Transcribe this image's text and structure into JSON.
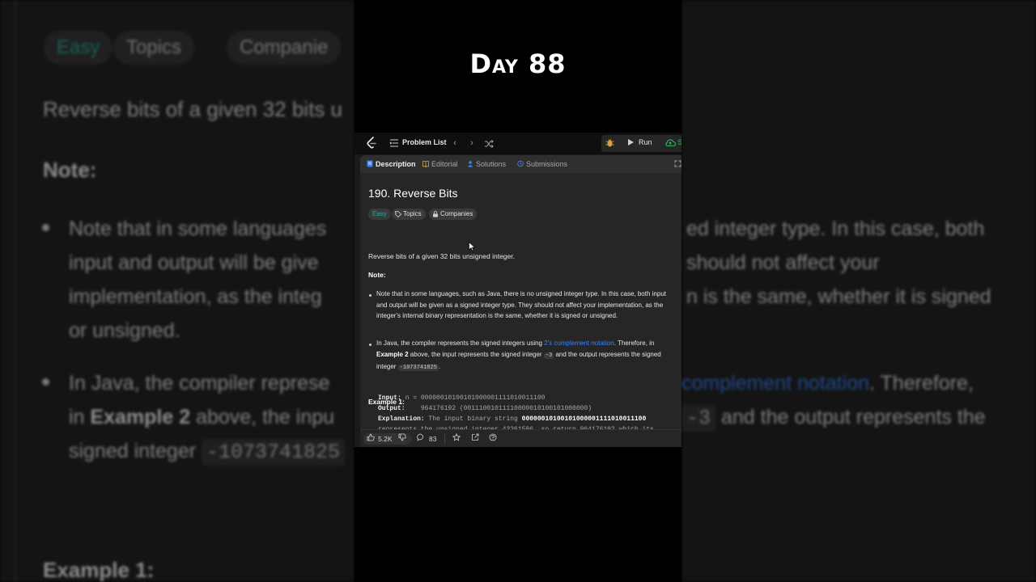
{
  "overlay": {
    "day_title": "Day 88"
  },
  "background": {
    "tags": [
      "Easy",
      "Topics",
      "Companie"
    ],
    "intro": "Reverse bits of a given 32 bits u",
    "note_heading": "Note:",
    "left_lines": [
      "Note that in some languages",
      "input and output will be give",
      "implementation, as the integ",
      "or unsigned.",
      "In Java, the compiler represe",
      "above, the inpu",
      "signed integer"
    ],
    "left_example2": "Example 2",
    "left_in": "in",
    "left_code": "-1073741825",
    "right_lines": [
      "ed integer type. In this case, both",
      "should not affect your",
      "n is the same, whether it is signed"
    ],
    "right_link": "complement notation",
    "right_therefore": ". Therefore,",
    "right_code": "-3",
    "right_tail": " and the output represents the",
    "example_heading": "Example 1:"
  },
  "topbar": {
    "problem_list": "Problem List",
    "run": "Run",
    "submit": "S"
  },
  "tabs": [
    "Description",
    "Editorial",
    "Solutions",
    "Submissions"
  ],
  "problem": {
    "title": "190. Reverse Bits",
    "tags": {
      "difficulty": "Easy",
      "topics": "Topics",
      "companies": "Companies"
    },
    "intro": "Reverse bits of a given 32 bits unsigned integer.",
    "note_heading": "Note:",
    "bullet1": "Note that in some languages, such as Java, there is no unsigned integer type. In this case, both input and output will be given as a signed integer type. They should not affect your implementation, as the integer's internal binary representation is the same, whether it is signed or unsigned.",
    "bullet2_a": "In Java, the compiler represents the signed integers using ",
    "bullet2_link": "2's complement notation",
    "bullet2_b": ". Therefore, in ",
    "bullet2_bold": "Example 2",
    "bullet2_c": " above, the input represents the signed integer ",
    "bullet2_code1": "-3",
    "bullet2_d": " and the output represents the signed integer ",
    "bullet2_code2": "-1073741825",
    "bullet2_e": ".",
    "example_heading": "Example 1:",
    "example": {
      "input_key": "Input:",
      "input_val": "n = 00000010100101000001111010011100",
      "output_key": "Output:",
      "output_val": "964176192 (00111001011110000010100101000000)",
      "explanation_key": "Explanation:",
      "explanation_a": "The input binary string ",
      "explanation_bold": "00000010100101000001111010011100",
      "explanation_b": "represents the unsigned integer 43261596, so return 964176192 which its"
    }
  },
  "footer": {
    "likes": "5.2K",
    "comments": "83"
  },
  "colors": {
    "accent_blue": "#3b82f6",
    "easy_teal": "#2aa897",
    "submit_green": "#2cbb5d"
  },
  "icons": [
    "leetcode-logo-icon",
    "list-icon",
    "chevron-left-icon",
    "chevron-right-icon",
    "shuffle-icon",
    "debug-icon",
    "play-icon",
    "upload-cloud-icon",
    "description-icon",
    "editorial-icon",
    "solutions-icon",
    "submissions-icon",
    "expand-icon",
    "tag-icon",
    "lock-icon",
    "thumbs-up-icon",
    "thumbs-down-icon",
    "comment-icon",
    "star-icon",
    "share-icon",
    "help-icon"
  ]
}
